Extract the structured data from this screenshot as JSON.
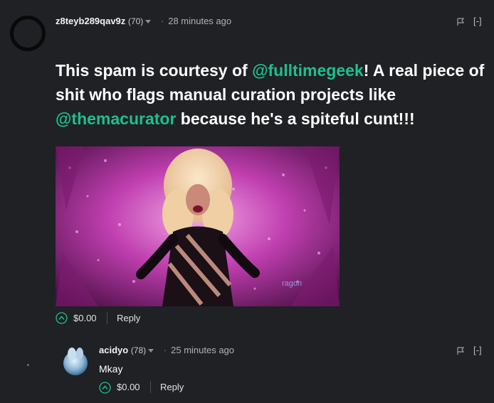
{
  "comments": [
    {
      "author": "z8teyb289qav9z",
      "reputation": "(70)",
      "time": "28 minutes ago",
      "collapse": "[-]",
      "body_parts": [
        {
          "text": "This spam is courtesy of ",
          "mention": false
        },
        {
          "text": "@fulltimegeek",
          "mention": true
        },
        {
          "text": "! A real piece of shit who flags manual curation projects like ",
          "mention": false
        },
        {
          "text": "@themacurator",
          "mention": true
        },
        {
          "text": " because he's a spiteful cunt!!!",
          "mention": false
        }
      ],
      "image_watermark": "ragon",
      "payout": "$0.00",
      "reply_label": "Reply"
    },
    {
      "author": "acidyo",
      "reputation": "(78)",
      "time": "25 minutes ago",
      "collapse": "[-]",
      "body": "Mkay",
      "payout": "$0.00",
      "reply_label": "Reply"
    }
  ],
  "colors": {
    "background": "#1f2124",
    "mention": "#1fbf8f",
    "upvote": "#1fbf8f"
  }
}
